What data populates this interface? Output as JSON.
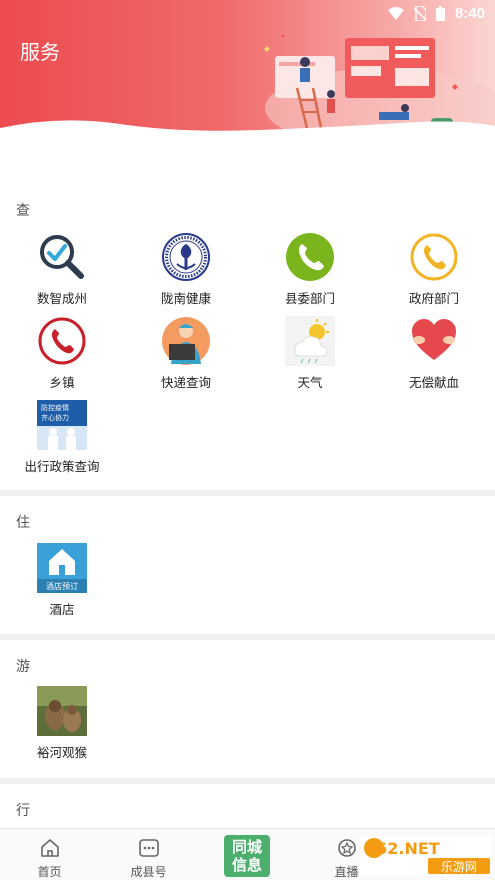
{
  "status_bar": {
    "time": "8:40"
  },
  "header": {
    "title": "服务"
  },
  "sections": [
    {
      "title": "查",
      "items": [
        {
          "label": "数智成州",
          "icon": "magnifier-check-icon"
        },
        {
          "label": "陇南健康",
          "icon": "health-emblem-icon"
        },
        {
          "label": "县委部门",
          "icon": "green-phone-icon"
        },
        {
          "label": "政府部门",
          "icon": "yellow-phone-icon"
        },
        {
          "label": "乡镇",
          "icon": "red-phone-icon"
        },
        {
          "label": "快递查询",
          "icon": "courier-icon"
        },
        {
          "label": "天气",
          "icon": "weather-icon"
        },
        {
          "label": "无偿献血",
          "icon": "heart-icon"
        },
        {
          "label": "出行政策查询",
          "icon": "travel-policy-icon"
        }
      ]
    },
    {
      "title": "住",
      "items": [
        {
          "label": "酒店",
          "icon": "hotel-icon",
          "badge": "酒店预订"
        }
      ]
    },
    {
      "title": "游",
      "items": [
        {
          "label": "裕河观猴",
          "icon": "monkey-photo-icon"
        }
      ]
    },
    {
      "title": "行",
      "items": []
    }
  ],
  "travel_policy_tile": {
    "line1": "防控疫情",
    "line2": "齐心协力"
  },
  "bottom_nav": {
    "items": [
      {
        "label": "首页",
        "icon": "home-icon"
      },
      {
        "label": "成县号",
        "icon": "chat-icon"
      },
      {
        "label": "直播",
        "icon": "live-icon"
      }
    ],
    "center": {
      "line1": "同城",
      "line2": "信息"
    }
  },
  "watermark": {
    "brand": "962.NET",
    "sub": "乐游网"
  },
  "colors": {
    "header_red": "#ec4b4f",
    "center_green": "#4caf6e"
  }
}
